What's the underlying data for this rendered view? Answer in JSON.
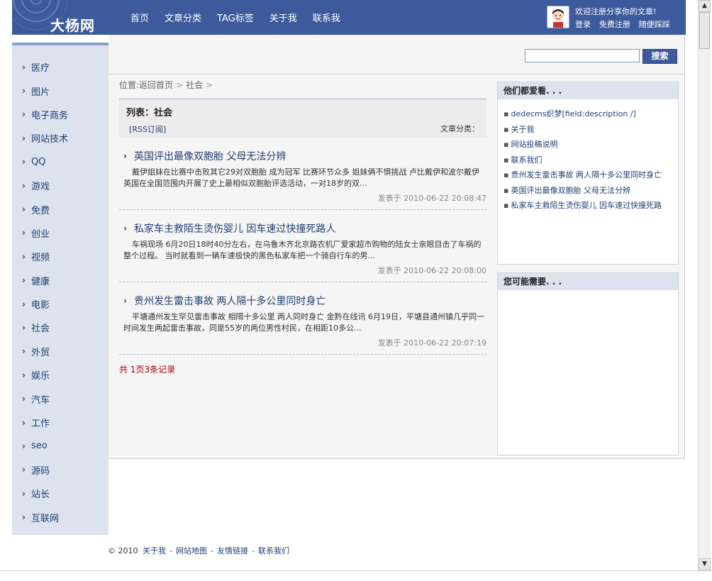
{
  "header": {
    "logo": "大杨网",
    "nav": [
      "首页",
      "文章分类",
      "TAG标签",
      "关于我",
      "联系我"
    ],
    "welcome": "欢迎注册分享你的文章!",
    "user_links": [
      "登录",
      "免费注册",
      "随便踩踩"
    ]
  },
  "sidebar": {
    "items": [
      "医疗",
      "图片",
      "电子商务",
      "网站技术",
      "QQ",
      "游戏",
      "免费",
      "创业",
      "视频",
      "健康",
      "电影",
      "社会",
      "外贸",
      "娱乐",
      "汽车",
      "工作",
      "seo",
      "源码",
      "站长",
      "互联网"
    ]
  },
  "search": {
    "value": "",
    "button_label": "搜索"
  },
  "breadcrumb": {
    "prefix": "位置:",
    "home": "返回首页",
    "sep1": ">",
    "current": "社会",
    "sep2": ">"
  },
  "list": {
    "title": "列表：社会",
    "rss": "[RSS订阅]",
    "category_label": "文章分类："
  },
  "articles": [
    {
      "title": "英国评出最像双胞胎 父母无法分辨",
      "desc": "戴伊姐妹在比赛中击败其它29对双胞胎 成为冠军 比赛环节众多 姐妹俩不惧挑战 卢比戴伊和波尔戴伊 英国在全国范围内开展了史上最相似双胞胎评选活动，一对18岁的双...",
      "meta": "发表于 2010-06-22 20:08:47"
    },
    {
      "title": "私家车主救陌生烫伤婴儿 因车速过快撞死路人",
      "desc": "车祸现场 6月20日18时40分左右，在乌鲁木齐北京路农机厂爱家超市购物的陆女士亲眼目击了车祸的整个过程。 当时就看到一辆车速极快的黑色私家车把一个骑自行车的男...",
      "meta": "发表于 2010-06-22 20:08:00"
    },
    {
      "title": "贵州发生雷击事故 两人隔十多公里同时身亡",
      "desc": "平塘通州发生罕见雷击事故 相隔十多公里 两人同时身亡 金黔在线讯 6月19日，平塘县通州镇几乎同一时间发生两起雷击事故，同是55岁的两位男性村民，在相距10多公...",
      "meta": "发表于 2010-06-22 20:07:19"
    }
  ],
  "pager": "共 1页3条记录",
  "right": {
    "box1_title": "他们都爱看. . .",
    "box1_items": [
      "dedecms织梦[field:description /]",
      "关于我",
      "网站投稿说明",
      "联系我们",
      "贵州发生雷击事故 两人隔十多公里同时身亡",
      "英国评出最像双胞胎 父母无法分辨",
      "私家车主救陌生烫伤婴儿 因车速过快撞死路"
    ],
    "box2_title": "您可能需要. . ."
  },
  "footer": {
    "copyright": "© 2010",
    "links": [
      "关于我",
      "网站地图",
      "友情链接",
      "联系我们"
    ],
    "sep": "-"
  }
}
